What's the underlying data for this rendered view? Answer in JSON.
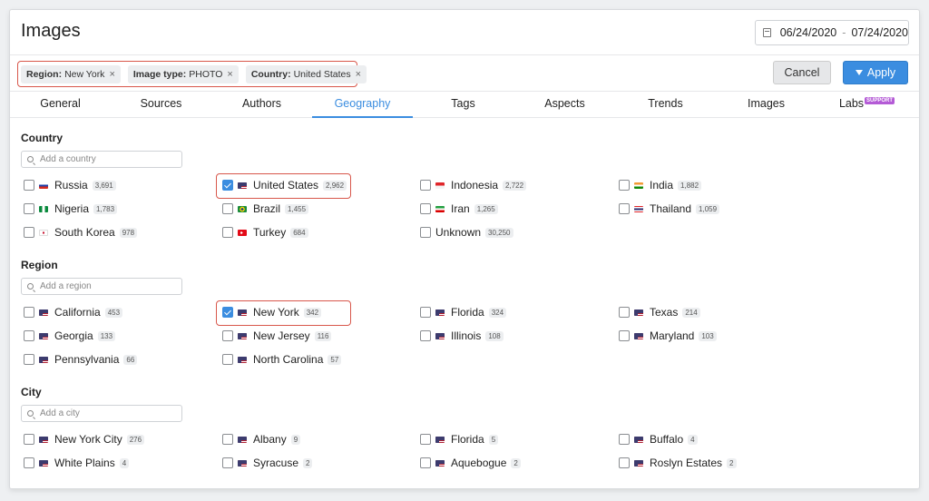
{
  "header": {
    "title": "Images",
    "date_from": "06/24/2020",
    "date_separator": "-",
    "date_to": "07/24/2020",
    "calendar_icon": "calendar-icon"
  },
  "filters": [
    {
      "key": "Region:",
      "value": "New York",
      "remove": "×"
    },
    {
      "key": "Image type:",
      "value": "PHOTO",
      "remove": "×"
    },
    {
      "key": "Country:",
      "value": "United States",
      "remove": "×"
    }
  ],
  "actions": {
    "cancel": "Cancel",
    "apply": "Apply",
    "apply_icon": "funnel-icon",
    "accent": "#3b8de0"
  },
  "tabs": [
    {
      "label": "General"
    },
    {
      "label": "Sources"
    },
    {
      "label": "Authors"
    },
    {
      "label": "Geography",
      "active": true
    },
    {
      "label": "Tags"
    },
    {
      "label": "Aspects"
    },
    {
      "label": "Trends"
    },
    {
      "label": "Images"
    },
    {
      "label": "Labs",
      "badge": "SUPPORT"
    }
  ],
  "country": {
    "title": "Country",
    "placeholder": "Add a country",
    "items": [
      {
        "name": "Russia",
        "count": "3,691",
        "flag": "russia"
      },
      {
        "name": "United States",
        "count": "2,962",
        "flag": "usa",
        "checked": true
      },
      {
        "name": "Indonesia",
        "count": "2,722",
        "flag": "indonesia"
      },
      {
        "name": "India",
        "count": "1,882",
        "flag": "india"
      },
      {
        "name": "Nigeria",
        "count": "1,783",
        "flag": "nigeria"
      },
      {
        "name": "Brazil",
        "count": "1,455",
        "flag": "brazil"
      },
      {
        "name": "Iran",
        "count": "1,265",
        "flag": "iran"
      },
      {
        "name": "Thailand",
        "count": "1,059",
        "flag": "thailand"
      },
      {
        "name": "South Korea",
        "count": "978",
        "flag": "korea"
      },
      {
        "name": "Turkey",
        "count": "684",
        "flag": "turkey"
      },
      {
        "name": "Unknown",
        "count": "30,250",
        "flag": "none"
      }
    ]
  },
  "region": {
    "title": "Region",
    "placeholder": "Add a region",
    "items": [
      {
        "name": "California",
        "count": "453",
        "flag": "usa"
      },
      {
        "name": "New York",
        "count": "342",
        "flag": "usa",
        "checked": true
      },
      {
        "name": "Florida",
        "count": "324",
        "flag": "usa"
      },
      {
        "name": "Texas",
        "count": "214",
        "flag": "usa"
      },
      {
        "name": "Georgia",
        "count": "133",
        "flag": "usa"
      },
      {
        "name": "New Jersey",
        "count": "116",
        "flag": "usa"
      },
      {
        "name": "Illinois",
        "count": "108",
        "flag": "usa"
      },
      {
        "name": "Maryland",
        "count": "103",
        "flag": "usa"
      },
      {
        "name": "Pennsylvania",
        "count": "66",
        "flag": "usa"
      },
      {
        "name": "North Carolina",
        "count": "57",
        "flag": "usa"
      }
    ]
  },
  "city": {
    "title": "City",
    "placeholder": "Add a city",
    "items": [
      {
        "name": "New York City",
        "count": "276",
        "flag": "usa"
      },
      {
        "name": "Albany",
        "count": "9",
        "flag": "usa"
      },
      {
        "name": "Florida",
        "count": "5",
        "flag": "usa"
      },
      {
        "name": "Buffalo",
        "count": "4",
        "flag": "usa"
      },
      {
        "name": "White Plains",
        "count": "4",
        "flag": "usa"
      },
      {
        "name": "Syracuse",
        "count": "2",
        "flag": "usa"
      },
      {
        "name": "Aquebogue",
        "count": "2",
        "flag": "usa"
      },
      {
        "name": "Roslyn Estates",
        "count": "2",
        "flag": "usa"
      }
    ]
  }
}
